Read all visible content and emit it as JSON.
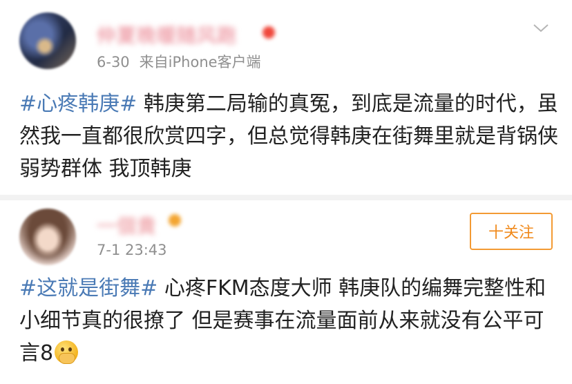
{
  "posts": [
    {
      "username": "仲夏晚暖随风跑",
      "time": "6-30",
      "source": "来自iPhone客户端",
      "hashtag": "#心疼韩庚#",
      "text": " 韩庚第二局输的真冤，到底是流量的时代，虽然我一直都很欣赏四字，但总觉得韩庚在街舞里就是背锅侠 弱势群体 我顶韩庚"
    },
    {
      "username": "一個貴",
      "time": "7-1 23:43",
      "follow_label": "十关注",
      "hashtag": "#这就是街舞#",
      "text": " 心疼FKM态度大师 韩庚队的编舞完整性和小细节真的很撩了 但是赛事在流量面前从来就没有公平可言8",
      "emoji": "face-with-hand-over-mouth"
    }
  ],
  "colors": {
    "hashtag": "#4a7ab5",
    "follow_accent": "#f39a33",
    "meta_text": "#8f8f8f"
  }
}
